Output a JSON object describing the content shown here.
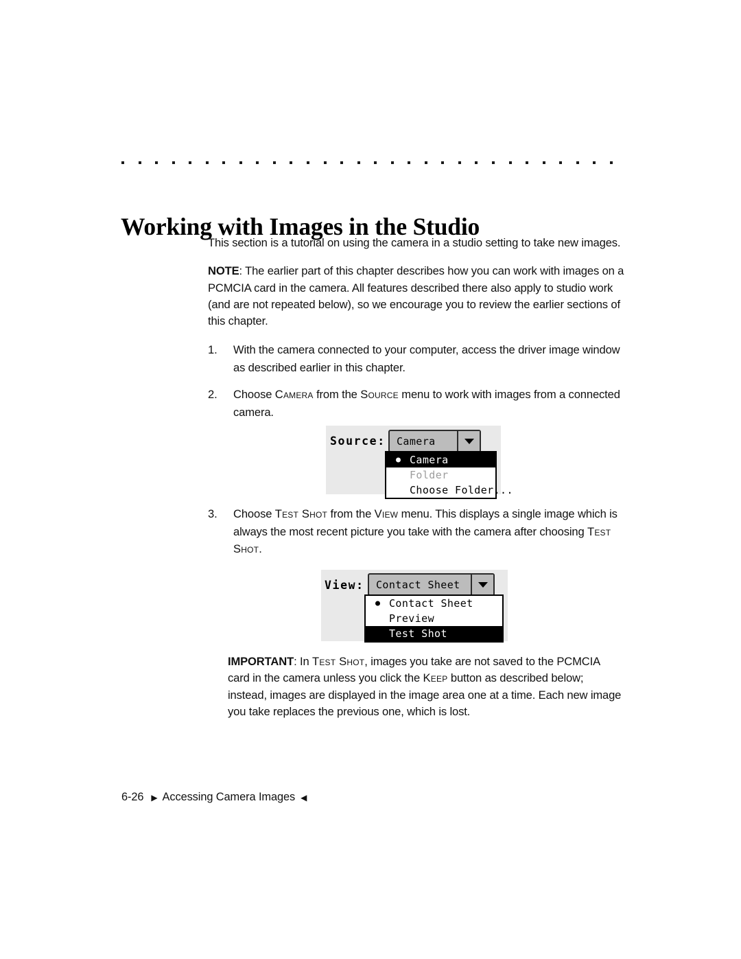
{
  "page": {
    "heading": "Working with Images in the Studio",
    "intro": "This section is a tutorial on using the camera in a studio setting to take new images.",
    "note_label": "NOTE",
    "note_body": ": The earlier part of this chapter describes how you can work with images on a PCMCIA card in the camera. All features described there also apply to studio work (and are not repeated below), so we encourage you to review the earlier sections of this chapter.",
    "important_label": "IMPORTANT",
    "important_1": ": In ",
    "important_sc_1": "Test Shot",
    "important_2": ", images you take are not saved to the PCMCIA card in the camera unless you click the ",
    "important_sc_2": "Keep",
    "important_3": " button as described below; instead, images are displayed in the image area one at a time. Each new image you take replaces the previous one, which is lost."
  },
  "steps": [
    {
      "num": "1.",
      "text_1": "With the camera connected to your computer, access the driver image window as described earlier in this chapter.",
      "sc_1": "",
      "text_2": "",
      "sc_2": "",
      "text_3": ""
    },
    {
      "num": "2.",
      "text_1": "Choose ",
      "sc_1": "Camera",
      "text_2": " from the ",
      "sc_2": "Source",
      "text_3": " menu to work with images from a connected camera."
    },
    {
      "num": "3.",
      "text_1": "Choose ",
      "sc_1": "Test Shot",
      "text_2": " from the ",
      "sc_2": "View",
      "text_3": " menu. This displays a single image which is always the most recent picture you take with the camera after choosing ",
      "sc_3": "Test Shot",
      "text_4": "."
    }
  ],
  "figure_source": {
    "label": "Source:",
    "selected_value": "Camera",
    "arrow_icon": "chevron-down-icon",
    "options": [
      {
        "label": "Camera",
        "state": "selected",
        "bullet": true
      },
      {
        "label": "Folder",
        "state": "disabled",
        "bullet": false
      },
      {
        "label": "Choose Folder...",
        "state": "normal",
        "bullet": false
      }
    ]
  },
  "figure_view": {
    "label": "View:",
    "selected_value": "Contact Sheet",
    "arrow_icon": "chevron-down-icon",
    "options": [
      {
        "label": "Contact Sheet",
        "state": "normal",
        "bullet": true
      },
      {
        "label": "Preview",
        "state": "normal",
        "bullet": false
      },
      {
        "label": "Test Shot",
        "state": "selected",
        "bullet": false
      }
    ]
  },
  "footer": {
    "page_number": "6-26",
    "marker_left": "▶",
    "text": "Accessing Camera Images",
    "marker_right": "◀"
  },
  "colors": {
    "page_background": "#ffffff",
    "text": "#111111",
    "figure_background": "#e9e9e9",
    "combo_face": "#bcbcbc",
    "combo_border": "#2b2b2b",
    "menu_highlight": "#000000",
    "menu_disabled_text": "#9d9d9d"
  }
}
